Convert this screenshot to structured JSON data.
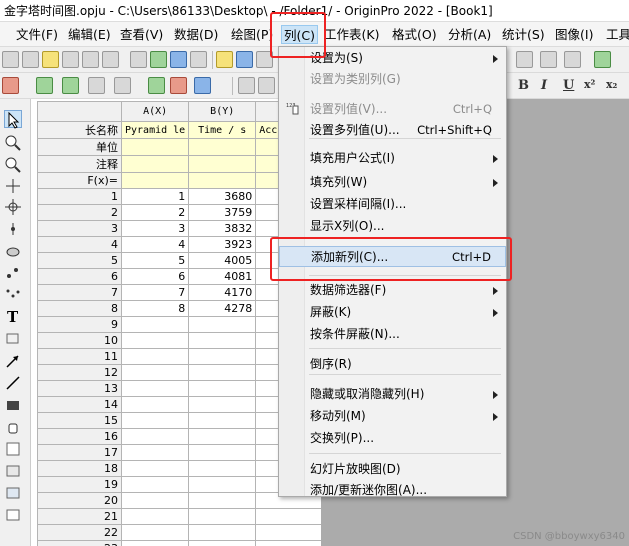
{
  "window": {
    "title": "金字塔时间图.opju - C:\\Users\\86133\\Desktop\\ - /Folder1/ - OriginPro 2022 - [Book1]"
  },
  "menubar": {
    "items": [
      {
        "label": "文件(F)"
      },
      {
        "label": "编辑(E)"
      },
      {
        "label": "查看(V)"
      },
      {
        "label": "数据(D)"
      },
      {
        "label": "绘图(P)"
      },
      {
        "label": "列(C)"
      },
      {
        "label": "工作表(K)"
      },
      {
        "label": "格式(O)"
      },
      {
        "label": "分析(A)"
      },
      {
        "label": "统计(S)"
      },
      {
        "label": "图像(I)"
      },
      {
        "label": "工具"
      }
    ],
    "active_index": 5
  },
  "toolbar": {
    "format_buttons": [
      "B",
      "I",
      "U",
      "x²",
      "x₂"
    ]
  },
  "worksheet": {
    "columns": [
      {
        "header": "A(X)",
        "long_name": "Pyramid le",
        "units": "",
        "comments": "",
        "fx": ""
      },
      {
        "header": "B(Y)",
        "long_name": "Time / s",
        "units": "",
        "comments": "",
        "fx": ""
      },
      {
        "header": "",
        "long_name": "Acc",
        "units": "",
        "comments": "",
        "fx": ""
      }
    ],
    "meta_labels": [
      "长名称",
      "单位",
      "注释",
      "F(x)="
    ],
    "row_numbers": [
      "1",
      "2",
      "3",
      "4",
      "5",
      "6",
      "7",
      "8",
      "9",
      "10",
      "11",
      "12",
      "13",
      "14",
      "15",
      "16",
      "17",
      "18",
      "19",
      "20",
      "21",
      "22",
      "23"
    ],
    "rows": [
      [
        "1",
        "3680",
        ""
      ],
      [
        "2",
        "3759",
        ""
      ],
      [
        "3",
        "3832",
        ""
      ],
      [
        "4",
        "3923",
        ""
      ],
      [
        "5",
        "4005",
        ""
      ],
      [
        "6",
        "4081",
        ""
      ],
      [
        "7",
        "4170",
        ""
      ],
      [
        "8",
        "4278",
        ""
      ]
    ]
  },
  "column_menu": {
    "items": [
      {
        "label": "设置为(S)",
        "shortcut": "",
        "submenu": true,
        "disabled": false
      },
      {
        "label": "设置为类别列(G)",
        "shortcut": "",
        "submenu": false,
        "disabled": true
      },
      {
        "label": "设置列值(V)...",
        "shortcut": "Ctrl+Q",
        "submenu": false,
        "disabled": true
      },
      {
        "label": "设置多列值(U)...",
        "shortcut": "Ctrl+Shift+Q",
        "submenu": false,
        "disabled": false
      },
      {
        "label": "填充用户公式(I)",
        "shortcut": "",
        "submenu": true,
        "disabled": false
      },
      {
        "label": "填充列(W)",
        "shortcut": "",
        "submenu": true,
        "disabled": false
      },
      {
        "label": "设置采样间隔(I)...",
        "shortcut": "",
        "submenu": false,
        "disabled": false
      },
      {
        "label": "显示X列(O)...",
        "shortcut": "",
        "submenu": false,
        "disabled": false
      },
      {
        "label": "添加新列(C)...",
        "shortcut": "Ctrl+D",
        "submenu": false,
        "disabled": false
      },
      {
        "label": "数据筛选器(F)",
        "shortcut": "",
        "submenu": true,
        "disabled": false
      },
      {
        "label": "屏蔽(K)",
        "shortcut": "",
        "submenu": true,
        "disabled": false
      },
      {
        "label": "按条件屏蔽(N)...",
        "shortcut": "",
        "submenu": false,
        "disabled": false
      },
      {
        "label": "倒序(R)",
        "shortcut": "",
        "submenu": false,
        "disabled": false
      },
      {
        "label": "隐藏或取消隐藏列(H)",
        "shortcut": "",
        "submenu": true,
        "disabled": false
      },
      {
        "label": "移动列(M)",
        "shortcut": "",
        "submenu": true,
        "disabled": false
      },
      {
        "label": "交换列(P)...",
        "shortcut": "",
        "submenu": false,
        "disabled": false
      },
      {
        "label": "幻灯片放映图(D)",
        "shortcut": "",
        "submenu": false,
        "disabled": false
      },
      {
        "label": "添加/更新迷你图(A)...",
        "shortcut": "",
        "submenu": false,
        "disabled": false
      }
    ],
    "highlighted_index": 8
  },
  "watermark": "CSDN @bboywxy6340",
  "colors": {
    "annotation_red": "#ee2222",
    "menu_highlight": "#d8e6f5",
    "meta_row_yellow": "#ffffd2"
  }
}
